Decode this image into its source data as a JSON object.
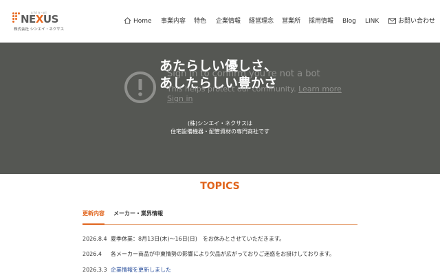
{
  "brand": {
    "small": "shin-ei",
    "word_prefix": "NE",
    "word_x": "X",
    "word_suffix": "US",
    "sub": "株式会社 シンエイ・ネクサス",
    "accent_color": "#e8681f"
  },
  "nav": {
    "items": [
      {
        "label": "Home",
        "icon": "home-icon"
      },
      {
        "label": "事業内容"
      },
      {
        "label": "特色"
      },
      {
        "label": "企業情報"
      },
      {
        "label": "経営理念"
      },
      {
        "label": "営業所"
      },
      {
        "label": "採用情報"
      },
      {
        "label": "Blog"
      },
      {
        "label": "LINK"
      },
      {
        "label": "お問い合わせ",
        "icon": "mail-icon"
      }
    ]
  },
  "hero": {
    "title_line1": "あたらしい優しさ、",
    "title_line2": "あしたらしい豊かさ",
    "sub_line1": "(株)シンエイ・ネクサスは",
    "sub_line2": "住宅設備機器・配管資材の専門商社です",
    "background_color": "#555753"
  },
  "bot_overlay": {
    "icon": "alert-circle-icon",
    "heading": "Sign in to confirm you're not a bot",
    "body": "This helps protect our community.",
    "learn_more": "Learn more",
    "sign_in": "Sign in"
  },
  "topics": {
    "title": "TOPICS",
    "accent_color": "#e0641c",
    "tabs": [
      {
        "label": "更新内容",
        "active": true
      },
      {
        "label": "メーカー・業界情報",
        "active": false
      }
    ],
    "news": [
      {
        "date": "2026.8.4",
        "text": "夏季休業：8月13日(木)～16日(日)　をお休みとさせていただきます。",
        "link": false
      },
      {
        "date": "2026.4",
        "text": "各メーカー商品が中東情勢の影響により欠品が広がっておりご迷惑をお掛けしております。",
        "link": false
      },
      {
        "date": "2026.3.3",
        "text": "企業情報を更新しました",
        "link": true
      }
    ]
  }
}
